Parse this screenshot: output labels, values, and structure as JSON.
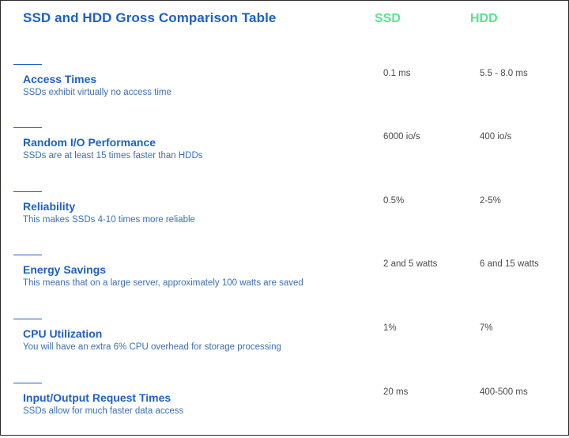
{
  "table": {
    "title": "SSD and HDD Gross Comparison Table",
    "columns": [
      "SSD",
      "HDD"
    ],
    "rows": [
      {
        "label": "Access Times",
        "description": "SSDs exhibit virtually no access time",
        "ssd": "0.1 ms",
        "hdd": "5.5 - 8.0 ms"
      },
      {
        "label": "Random I/O Performance",
        "description": "SSDs are at least 15 times faster than HDDs",
        "ssd": "6000 io/s",
        "hdd": "400 io/s"
      },
      {
        "label": "Reliability",
        "description": "This makes SSDs 4-10 times more reliable",
        "ssd": "0.5%",
        "hdd": "2-5%"
      },
      {
        "label": "Energy Savings",
        "description": "This means that on a large server, approximately 100 watts are saved",
        "ssd": "2 and 5 watts",
        "hdd": "6 and 15 watts"
      },
      {
        "label": "CPU Utilization",
        "description": "You will have an extra 6% CPU overhead for storage processing",
        "ssd": "1%",
        "hdd": "7%"
      },
      {
        "label": "Input/Output Request Times",
        "description": "SSDs allow for much faster data access",
        "ssd": "20 ms",
        "hdd": "400-500 ms"
      }
    ]
  },
  "colors": {
    "title": "#1f5fc4",
    "column_header": "#57e58f",
    "row_label": "#1f5fc4",
    "row_description": "#3c6fb0",
    "value_text": "#4a4a4a",
    "border": "#2b2b2b"
  }
}
